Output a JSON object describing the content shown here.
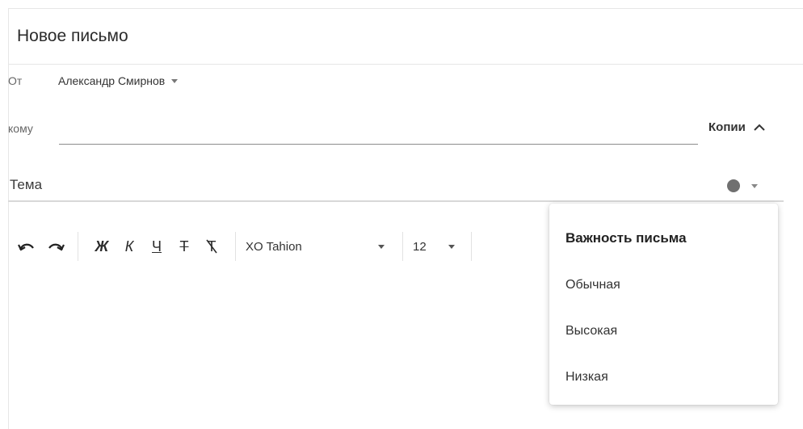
{
  "header": {
    "title": "Новое письмо"
  },
  "from": {
    "label": "От",
    "value": "Александр Смирнов"
  },
  "to": {
    "label": "кому",
    "value": ""
  },
  "cc": {
    "label": "Копии"
  },
  "subject": {
    "placeholder": "Тема",
    "value": ""
  },
  "importance": {
    "indicator_color": "#707070"
  },
  "toolbar": {
    "undo_icon": "undo-icon",
    "redo_icon": "redo-icon",
    "bold": "Ж",
    "italic": "К",
    "underline": "Ч",
    "strike": "Т",
    "clear_format": "Т",
    "font_family": "XO Tahion",
    "font_size": "12"
  },
  "importance_menu": {
    "title": "Важность письма",
    "items": [
      "Обычная",
      "Высокая",
      "Низкая"
    ]
  }
}
